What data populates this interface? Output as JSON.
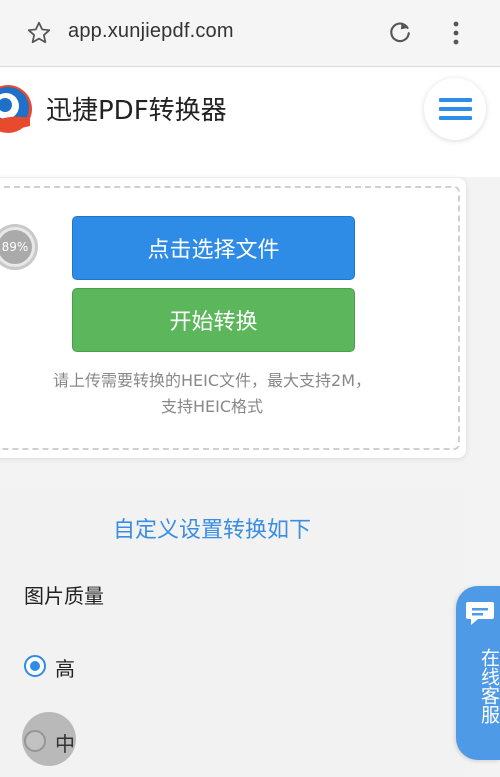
{
  "browser": {
    "url": "app.xunjiepdf.com",
    "icons": [
      "star-icon",
      "reload-icon",
      "more-vert-icon"
    ]
  },
  "site": {
    "title": "迅捷PDF转换器",
    "logo_icon": "xunjie-logo",
    "menu_icon": "hamburger-icon"
  },
  "upload": {
    "progress_label": "89%",
    "progress_value": 89,
    "select_button": "点击选择文件",
    "convert_button": "开始转换",
    "hint_line1": "请上传需要转换的HEIC文件，最大支持2M，",
    "hint_line2": "支持HEIC格式"
  },
  "settings": {
    "title": "自定义设置转换如下",
    "quality_label": "图片质量",
    "options": [
      {
        "label": "高",
        "selected": true
      },
      {
        "label": "中",
        "selected": false
      }
    ]
  },
  "service": {
    "label": "在线客服",
    "icon": "chat-bubble-icon"
  },
  "colors": {
    "primary_blue": "#2e8ce6",
    "convert_green": "#5cb75c",
    "title_blue": "#3a8ee0",
    "service_blue": "#4f9ae6"
  }
}
